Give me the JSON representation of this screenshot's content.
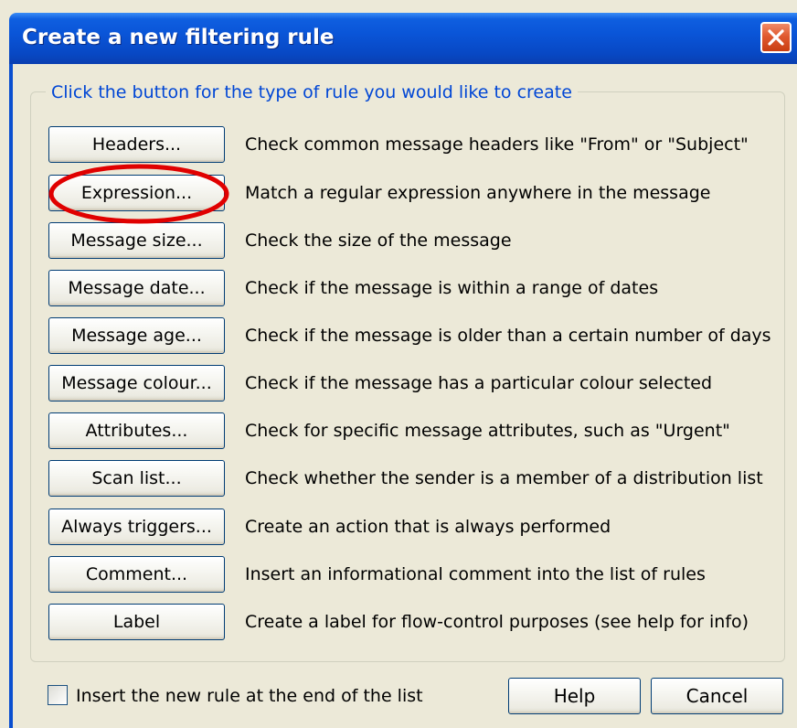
{
  "window": {
    "title": "Create a new filtering rule",
    "close_icon": "close-x-icon"
  },
  "group": {
    "legend": "Click the button for the type of rule you would like to create"
  },
  "rules": [
    {
      "button": "Headers...",
      "description": "Check common message headers like \"From\" or \"Subject\""
    },
    {
      "button": "Expression...",
      "description": "Match a regular expression anywhere in the message"
    },
    {
      "button": "Message size...",
      "description": "Check the size of the message"
    },
    {
      "button": "Message date...",
      "description": "Check if the message is within a range of dates"
    },
    {
      "button": "Message age...",
      "description": "Check if the message is older than a certain number of days"
    },
    {
      "button": "Message colour...",
      "description": "Check if the message has a particular colour selected"
    },
    {
      "button": "Attributes...",
      "description": "Check for specific message attributes, such as \"Urgent\""
    },
    {
      "button": "Scan list...",
      "description": "Check whether the sender is a member of a distribution list"
    },
    {
      "button": "Always triggers...",
      "description": "Create an action that is always performed"
    },
    {
      "button": "Comment...",
      "description": "Insert an informational comment into the list of rules"
    },
    {
      "button": "Label",
      "description": "Create a label for flow-control purposes (see help for info)"
    }
  ],
  "annotation": {
    "highlight_color": "#e00000",
    "highlighted_button": "Expression..."
  },
  "footer": {
    "checkbox_label": "Insert the new rule at the end of the list",
    "checkbox_checked": false,
    "help_label": "Help",
    "cancel_label": "Cancel"
  },
  "colors": {
    "titlebar": "#0a55d8",
    "legend_text": "#0046d5",
    "dialog_bg": "#ece9d8",
    "close_button": "#e05a30"
  }
}
